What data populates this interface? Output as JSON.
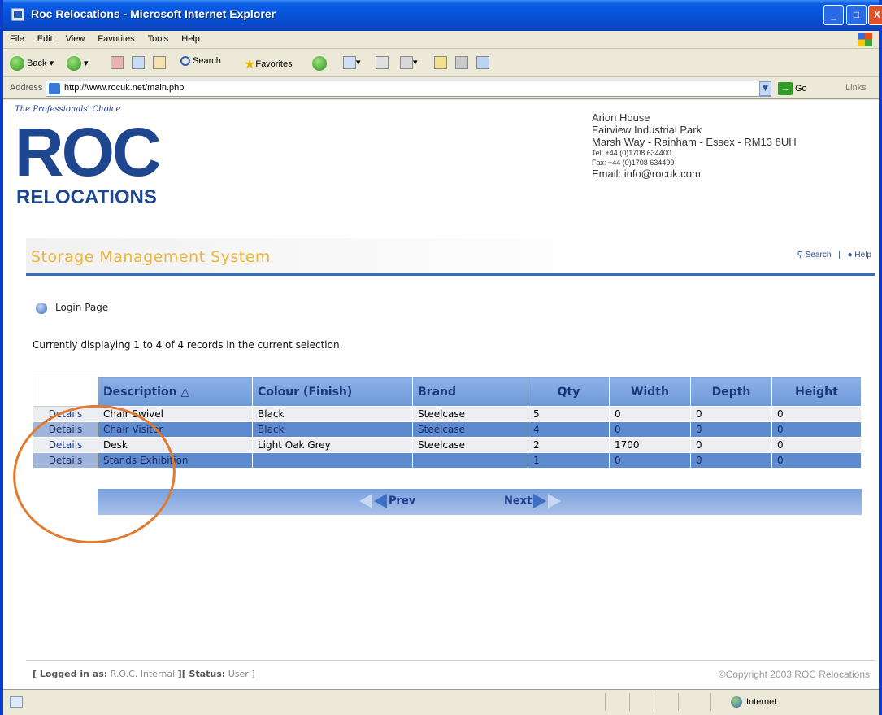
{
  "window": {
    "title": "Roc Relocations - Microsoft Internet Explorer",
    "buttons": {
      "minimize": "_",
      "maximize": "□",
      "close": "X"
    }
  },
  "menu": [
    "File",
    "Edit",
    "View",
    "Favorites",
    "Tools",
    "Help"
  ],
  "toolbar": {
    "back": "Back",
    "search": "Search",
    "favorites": "Favorites"
  },
  "address": {
    "label": "Address",
    "url": "http://www.rocuk.net/main.php",
    "go": "Go",
    "links": "Links"
  },
  "header": {
    "tagline": "The Professionals' Choice",
    "logo_main": "ROC",
    "logo_sub": "RELOCATIONS",
    "address_lines": [
      "Arion House",
      "Fairview Industrial Park",
      "Marsh Way - Rainham - Essex - RM13 8UH"
    ],
    "tel": "Tel: +44 (0)1708 634400",
    "fax": "Fax: +44 (0)1708 634499",
    "email": "Email: info@rocuk.com"
  },
  "nav": {
    "title": "Storage Management System",
    "search": "Search",
    "separator": "|",
    "help": "Help"
  },
  "page": {
    "login_link": "Login Page",
    "records_text": "Currently displaying 1 to 4 of 4 records in the current selection."
  },
  "table": {
    "columns": [
      "Description △",
      "Colour (Finish)",
      "Brand",
      "Qty",
      "Width",
      "Depth",
      "Height"
    ],
    "detail_label": "Details",
    "rows": [
      {
        "description": "Chair Swivel",
        "colour": "Black",
        "brand": "Steelcase",
        "qty": "5",
        "width": "0",
        "depth": "0",
        "height": "0"
      },
      {
        "description": "Chair Visitor",
        "colour": "Black",
        "brand": "Steelcase",
        "qty": "4",
        "width": "0",
        "depth": "0",
        "height": "0"
      },
      {
        "description": "Desk",
        "colour": "Light Oak Grey",
        "brand": "Steelcase",
        "qty": "2",
        "width": "1700",
        "depth": "0",
        "height": "0"
      },
      {
        "description": "Stands Exhibition",
        "colour": "",
        "brand": "",
        "qty": "1",
        "width": "0",
        "depth": "0",
        "height": "0"
      }
    ],
    "prev": "Prev",
    "next": "Next"
  },
  "footer": {
    "logged_label": "[ Logged in as:",
    "logged_value": "R.O.C. Internal",
    "status_label": "][ Status:",
    "status_value": "User ]",
    "copyright": "©Copyright 2003 ROC Relocations"
  },
  "statusbar": {
    "zone": "Internet"
  }
}
